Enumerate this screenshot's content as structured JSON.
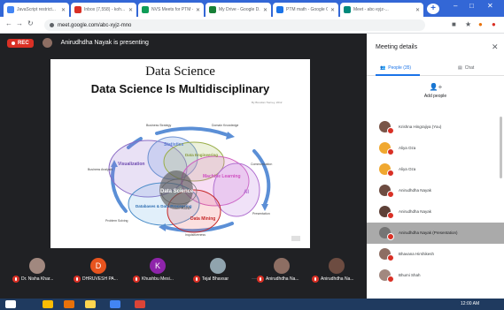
{
  "browser": {
    "tabs": [
      {
        "title": "JavaScript restrict...",
        "color": "#4285f4"
      },
      {
        "title": "Inbox (7,558) - koh...",
        "color": "#d93025"
      },
      {
        "title": "NVS Meets for PTM -",
        "color": "#0f9d58"
      },
      {
        "title": "My Drive - Google D...",
        "color": "#188038"
      },
      {
        "title": "PTM math - Google C...",
        "color": "#1a73e8"
      },
      {
        "title": "Meet - abc-xyjz-...",
        "color": "#00897b"
      }
    ],
    "url": "meet.google.com/abc-xyjz-mno",
    "window_controls": [
      "–",
      "□",
      "✕"
    ]
  },
  "meet": {
    "rec_label": "REC",
    "presenting_text": "Anirudhdha Nayak is presenting",
    "slide": {
      "title": "Data Science",
      "subtitle": "Data Science Is Multidisciplinary",
      "credit": "By Brendan Tierney, 2012",
      "center_label": "Data Science",
      "circle_labels": [
        {
          "text": "Visualization",
          "color": "#6e4bb0"
        },
        {
          "text": "Statistics",
          "color": "#5b7fd0"
        },
        {
          "text": "Data Engineering",
          "color": "#8a9a3c"
        },
        {
          "text": "Machine Learning",
          "color": "#d04fc0"
        },
        {
          "text": "AI",
          "color": "#b06ad0"
        },
        {
          "text": "Databases & Data Processing",
          "color": "#2b6cb0"
        },
        {
          "text": "Data Mining",
          "color": "#c62828"
        },
        {
          "text": "KDD",
          "color": "#555555"
        }
      ],
      "outer_labels": [
        {
          "text": "Business Strategy"
        },
        {
          "text": "Domain Knowledge"
        },
        {
          "text": "Communication"
        },
        {
          "text": "Presentation"
        },
        {
          "text": "Inquisitiveness"
        },
        {
          "text": "Problem Solving"
        },
        {
          "text": "Business Analysis"
        }
      ]
    },
    "tiles": [
      {
        "name": "Dr. Nisha Khar...",
        "initial": "",
        "color": "#a1887f"
      },
      {
        "name": "DHRUVESH PA...",
        "initial": "D",
        "color": "#e8541e"
      },
      {
        "name": "Khushbu Mesi...",
        "initial": "K",
        "color": "#8e24aa"
      },
      {
        "name": "Tejal Bhavsar",
        "initial": "",
        "color": "#90a4ae"
      },
      {
        "name": "Anirudhdha Na...",
        "initial": "",
        "color": "#8d6e63"
      },
      {
        "name": "Anirudhdha Na...",
        "initial": "",
        "color": "#6d4c41"
      }
    ],
    "more_dots": "···"
  },
  "panel": {
    "title": "Meeting details",
    "close": "✕",
    "tab_people": "People (35)",
    "tab_chat": "Chat",
    "add_people": "Add people",
    "participants": [
      {
        "name": "Krishna Hingrajiya (You)",
        "color": "#795548",
        "highlighted": false
      },
      {
        "name": "Aliya Oza",
        "color": "#f0a830",
        "highlighted": false
      },
      {
        "name": "Aliya Oza",
        "color": "#f0a830",
        "highlighted": false
      },
      {
        "name": "Anirudhdha Nayak",
        "color": "#6d4c41",
        "highlighted": false
      },
      {
        "name": "Anirudhdha Nayak",
        "color": "#5d4037",
        "highlighted": false
      },
      {
        "name": "Anirudhdha Nayak (Presentation)",
        "color": "#757575",
        "highlighted": true
      },
      {
        "name": "Bhavana Hirshikesh",
        "color": "#8d6e63",
        "highlighted": false
      },
      {
        "name": "Bhumi Shah",
        "color": "#a1887f",
        "highlighted": false
      }
    ]
  },
  "taskbar": {
    "tray": "12:00 AM",
    "apps": [
      {
        "color": "#ffffff"
      },
      {
        "color": "#fbbc04"
      },
      {
        "color": "#e8710a"
      },
      {
        "color": "#ffd54f"
      },
      {
        "color": "#4285f4"
      },
      {
        "color": "#db4437"
      }
    ]
  }
}
